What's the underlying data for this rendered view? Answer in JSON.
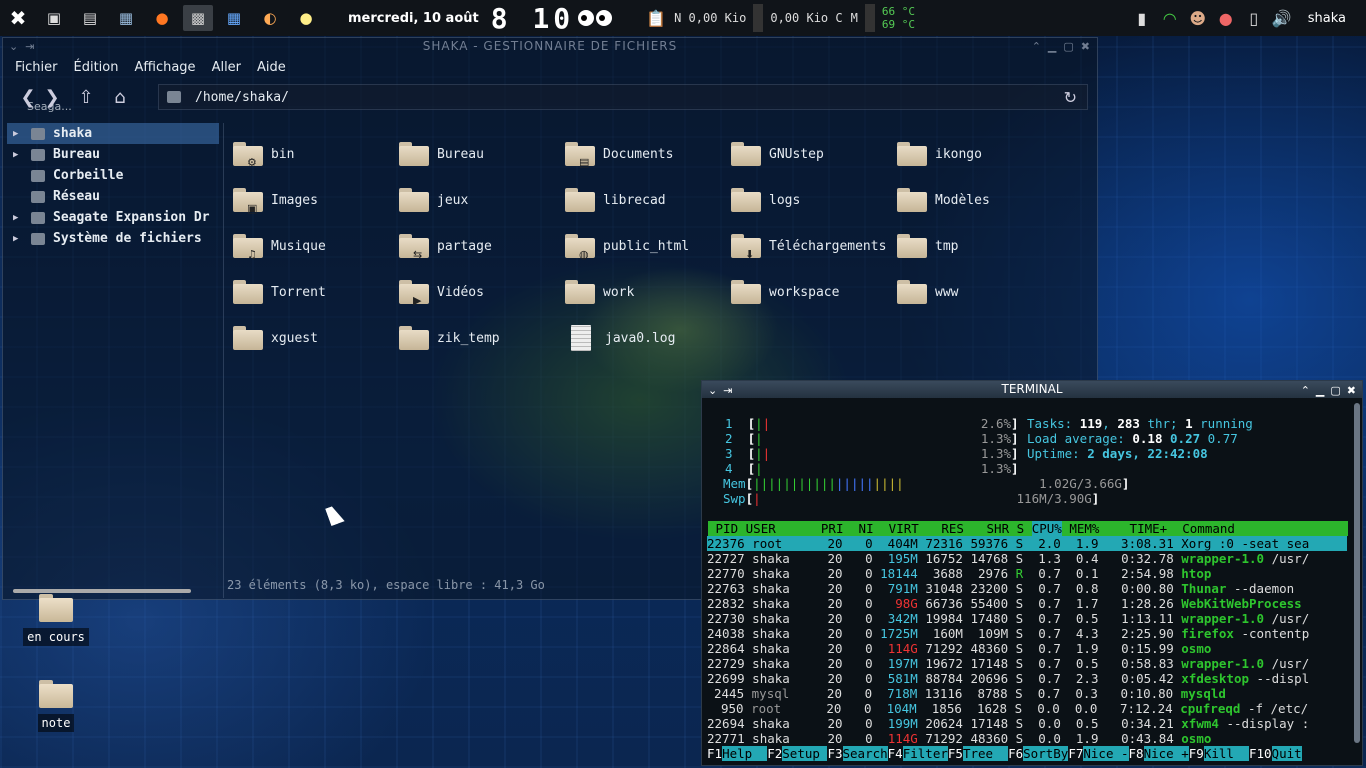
{
  "panel": {
    "date": "mercredi, 10 août",
    "clock": "8 10",
    "net_down": "N 0,00 Kio",
    "net_up": "0,00 Kio C",
    "mem_label": "M",
    "temp1": "66 °C",
    "temp2": "69 °C",
    "user": "shaka"
  },
  "fm": {
    "title": "SHAKA - GESTIONNAIRE DE FICHIERS",
    "menu": [
      "Fichier",
      "Édition",
      "Affichage",
      "Aller",
      "Aide"
    ],
    "overlay_label": "Seaga...",
    "path": "/home/shaka/",
    "sidebar": [
      {
        "label": "shaka",
        "expandable": true,
        "selected": true
      },
      {
        "label": "Bureau",
        "expandable": true,
        "selected": false
      },
      {
        "label": "Corbeille",
        "expandable": false,
        "selected": false
      },
      {
        "label": "Réseau",
        "expandable": false,
        "selected": false
      },
      {
        "label": "Seagate Expansion Dr",
        "expandable": true,
        "selected": false
      },
      {
        "label": "Système de fichiers",
        "expandable": true,
        "selected": false
      }
    ],
    "items": [
      {
        "name": "bin",
        "type": "folder",
        "emblem": "gear"
      },
      {
        "name": "Bureau",
        "type": "folder",
        "emblem": ""
      },
      {
        "name": "Documents",
        "type": "folder",
        "emblem": "document"
      },
      {
        "name": "GNUstep",
        "type": "folder",
        "emblem": ""
      },
      {
        "name": "ikongo",
        "type": "folder",
        "emblem": ""
      },
      {
        "name": "Images",
        "type": "folder",
        "emblem": "image"
      },
      {
        "name": "jeux",
        "type": "folder",
        "emblem": ""
      },
      {
        "name": "librecad",
        "type": "folder",
        "emblem": ""
      },
      {
        "name": "logs",
        "type": "folder",
        "emblem": ""
      },
      {
        "name": "Modèles",
        "type": "folder",
        "emblem": ""
      },
      {
        "name": "Musique",
        "type": "folder",
        "emblem": "music"
      },
      {
        "name": "partage",
        "type": "folder",
        "emblem": "share"
      },
      {
        "name": "public_html",
        "type": "folder",
        "emblem": "globe"
      },
      {
        "name": "Téléchargements",
        "type": "folder",
        "emblem": "download"
      },
      {
        "name": "tmp",
        "type": "folder",
        "emblem": ""
      },
      {
        "name": "Torrent",
        "type": "folder",
        "emblem": ""
      },
      {
        "name": "Vidéos",
        "type": "folder",
        "emblem": "video"
      },
      {
        "name": "work",
        "type": "folder",
        "emblem": ""
      },
      {
        "name": "workspace",
        "type": "folder",
        "emblem": ""
      },
      {
        "name": "www",
        "type": "folder",
        "emblem": ""
      },
      {
        "name": "xguest",
        "type": "folder",
        "emblem": ""
      },
      {
        "name": "zik_temp",
        "type": "folder",
        "emblem": ""
      },
      {
        "name": "java0.log",
        "type": "file",
        "emblem": ""
      }
    ],
    "status": "23 éléments (8,3 ko), espace libre : 41,3 Go"
  },
  "desktop": [
    {
      "label": "en cours"
    },
    {
      "label": "note"
    }
  ],
  "terminal": {
    "title": "TERMINAL",
    "cpus": [
      {
        "n": "1",
        "pct": "2.6%"
      },
      {
        "n": "2",
        "pct": "1.3%"
      },
      {
        "n": "3",
        "pct": "1.3%"
      },
      {
        "n": "4",
        "pct": "1.3%"
      }
    ],
    "mem_label": "Mem",
    "mem": "1.02G/3.66G",
    "swp_label": "Swp",
    "swp": "116M/3.90G",
    "tasks_label": "Tasks:",
    "tasks": "119",
    "thr": "283",
    "thr_label": "thr;",
    "running": "1",
    "running_label": "running",
    "load_label": "Load average:",
    "load1": "0.18",
    "load5": "0.27",
    "load15": "0.77",
    "uptime_label": "Uptime:",
    "uptime": "2 days, 22:42:08",
    "header": [
      "PID",
      "USER",
      "PRI",
      "NI",
      "VIRT",
      "RES",
      "SHR",
      "S",
      "CPU%",
      "MEM%",
      "TIME+",
      "Command"
    ],
    "rows": [
      [
        "22376",
        "root",
        "20",
        "0",
        "404M",
        "72316",
        "59376",
        "S",
        "2.0",
        "1.9",
        "3:08.31",
        "Xorg",
        ":0 -seat sea"
      ],
      [
        "22727",
        "shaka",
        "20",
        "0",
        "195M",
        "16752",
        "14768",
        "S",
        "1.3",
        "0.4",
        "0:32.78",
        "wrapper-1.0",
        "/usr/"
      ],
      [
        "22770",
        "shaka",
        "20",
        "0",
        "18144",
        "3688",
        "2976",
        "R",
        "0.7",
        "0.1",
        "2:54.98",
        "htop",
        ""
      ],
      [
        "22763",
        "shaka",
        "20",
        "0",
        "791M",
        "31048",
        "23200",
        "S",
        "0.7",
        "0.8",
        "0:00.80",
        "Thunar",
        "--daemon"
      ],
      [
        "22832",
        "shaka",
        "20",
        "0",
        "98G",
        "66736",
        "55400",
        "S",
        "0.7",
        "1.7",
        "1:28.26",
        "WebKitWebProcess",
        ""
      ],
      [
        "22730",
        "shaka",
        "20",
        "0",
        "342M",
        "19984",
        "17480",
        "S",
        "0.7",
        "0.5",
        "1:13.11",
        "wrapper-1.0",
        "/usr/"
      ],
      [
        "24038",
        "shaka",
        "20",
        "0",
        "1725M",
        "160M",
        "109M",
        "S",
        "0.7",
        "4.3",
        "2:25.90",
        "firefox",
        "-contentp"
      ],
      [
        "22864",
        "shaka",
        "20",
        "0",
        "114G",
        "71292",
        "48360",
        "S",
        "0.7",
        "1.9",
        "0:15.99",
        "osmo",
        ""
      ],
      [
        "22729",
        "shaka",
        "20",
        "0",
        "197M",
        "19672",
        "17148",
        "S",
        "0.7",
        "0.5",
        "0:58.83",
        "wrapper-1.0",
        "/usr/"
      ],
      [
        "22699",
        "shaka",
        "20",
        "0",
        "581M",
        "88784",
        "20696",
        "S",
        "0.7",
        "2.3",
        "0:05.42",
        "xfdesktop",
        "--displ"
      ],
      [
        "2445",
        "mysql",
        "20",
        "0",
        "718M",
        "13116",
        "8788",
        "S",
        "0.7",
        "0.3",
        "0:10.80",
        "mysqld",
        ""
      ],
      [
        "950",
        "root",
        "20",
        "0",
        "104M",
        "1856",
        "1628",
        "S",
        "0.0",
        "0.0",
        "7:12.24",
        "cpufreqd",
        "-f /etc/"
      ],
      [
        "22694",
        "shaka",
        "20",
        "0",
        "199M",
        "20624",
        "17148",
        "S",
        "0.0",
        "0.5",
        "0:34.21",
        "xfwm4",
        "--display :"
      ],
      [
        "22771",
        "shaka",
        "20",
        "0",
        "114G",
        "71292",
        "48360",
        "S",
        "0.0",
        "1.9",
        "0:43.84",
        "osmo",
        ""
      ]
    ],
    "fkeys": [
      {
        "k": "F1",
        "l": "Help  "
      },
      {
        "k": "F2",
        "l": "Setup "
      },
      {
        "k": "F3",
        "l": "Search"
      },
      {
        "k": "F4",
        "l": "Filter"
      },
      {
        "k": "F5",
        "l": "Tree  "
      },
      {
        "k": "F6",
        "l": "SortBy"
      },
      {
        "k": "F7",
        "l": "Nice -"
      },
      {
        "k": "F8",
        "l": "Nice +"
      },
      {
        "k": "F9",
        "l": "Kill  "
      },
      {
        "k": "F10",
        "l": "Quit"
      }
    ]
  },
  "colors": {
    "accent": "#23a8b4",
    "header_green": "#2cb52c",
    "selection": "#3c6eaa"
  }
}
